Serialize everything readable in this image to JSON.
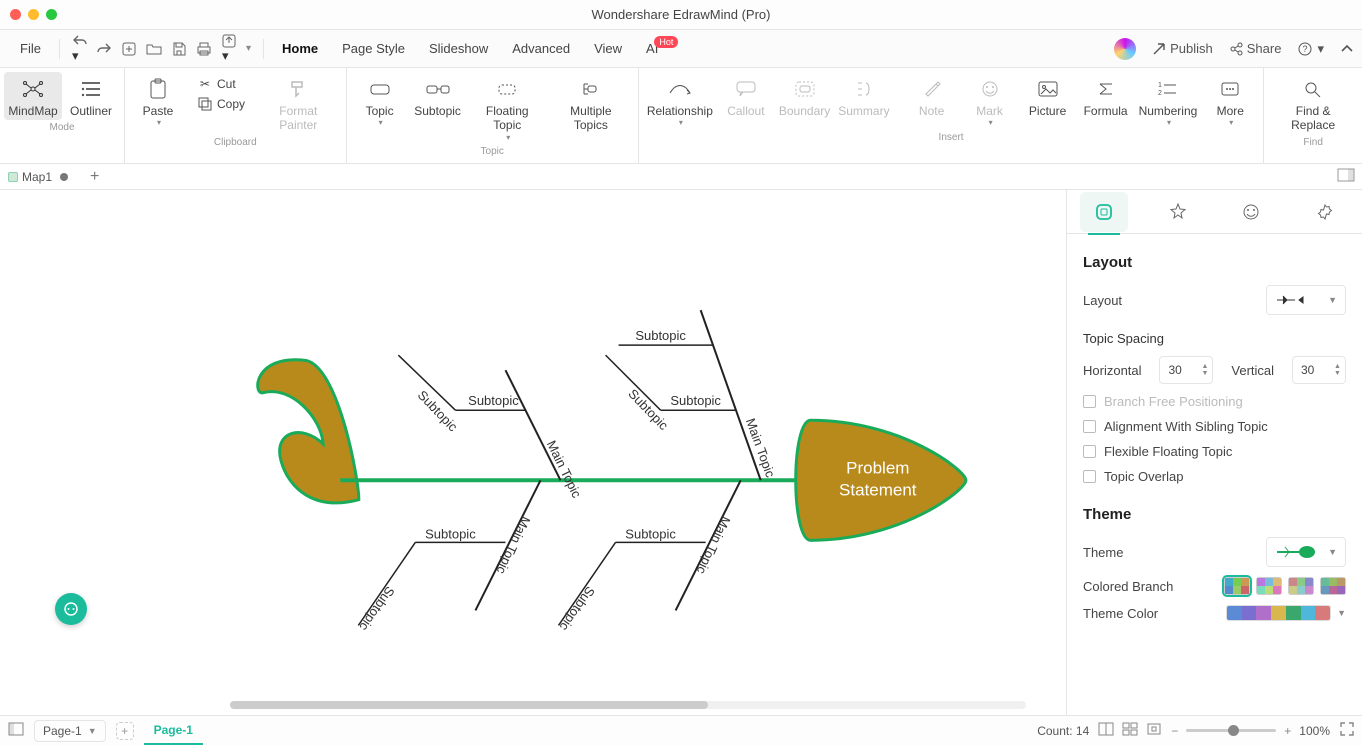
{
  "title": "Wondershare EdrawMind (Pro)",
  "menu": {
    "file": "File",
    "tabs": [
      "Home",
      "Page Style",
      "Slideshow",
      "Advanced",
      "View",
      "AI"
    ],
    "active": "Home",
    "ai_badge": "Hot",
    "publish": "Publish",
    "share": "Share"
  },
  "ribbon": {
    "mode": {
      "label": "Mode",
      "mindmap": "MindMap",
      "outliner": "Outliner"
    },
    "clipboard": {
      "label": "Clipboard",
      "paste": "Paste",
      "cut": "Cut",
      "copy": "Copy",
      "format_painter": "Format Painter"
    },
    "topic": {
      "label": "Topic",
      "topic": "Topic",
      "subtopic": "Subtopic",
      "floating": "Floating Topic",
      "multiple": "Multiple Topics"
    },
    "insert": {
      "label": "Insert",
      "relationship": "Relationship",
      "callout": "Callout",
      "boundary": "Boundary",
      "summary": "Summary",
      "note": "Note",
      "mark": "Mark",
      "picture": "Picture",
      "formula": "Formula",
      "numbering": "Numbering",
      "more": "More"
    },
    "find": {
      "label": "Find",
      "find_replace": "Find & Replace"
    }
  },
  "doc_tabs": {
    "name": "Map1"
  },
  "panel": {
    "layout_h": "Layout",
    "layout_label": "Layout",
    "topic_spacing": "Topic Spacing",
    "horizontal": "Horizontal",
    "horizontal_val": "30",
    "vertical": "Vertical",
    "vertical_val": "30",
    "branch_free": "Branch Free Positioning",
    "align_sibling": "Alignment With Sibling Topic",
    "flex_float": "Flexible Floating Topic",
    "overlap": "Topic Overlap",
    "theme_h": "Theme",
    "theme_label": "Theme",
    "colored_branch": "Colored Branch",
    "theme_color": "Theme Color"
  },
  "fishbone": {
    "head": "Problem Statement",
    "main_topic": "Main Topic",
    "subtopic": "Subtopic"
  },
  "status": {
    "page_sel": "Page-1",
    "page_tab": "Page-1",
    "count_label": "Count:",
    "count": "14",
    "zoom": "100%"
  }
}
